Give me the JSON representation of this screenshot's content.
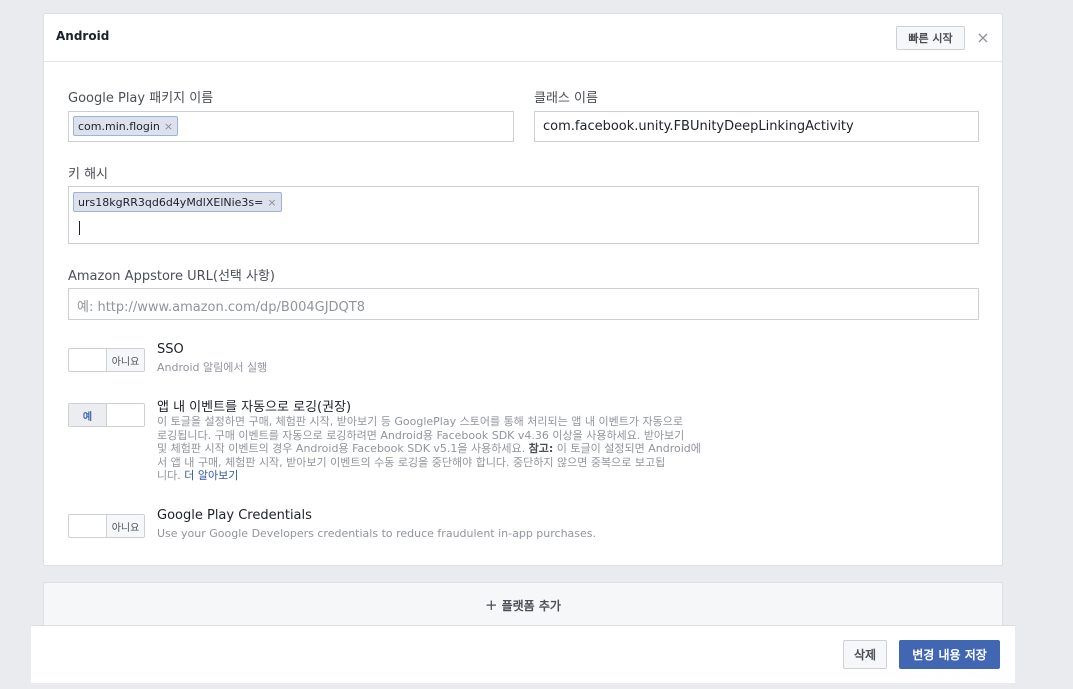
{
  "panel": {
    "title": "Android",
    "quick_start_label": "빠른 시작",
    "close_glyph": "×"
  },
  "package": {
    "label": "Google Play 패키지 이름",
    "token": "com.min.flogin",
    "token_remove": "×"
  },
  "class_name": {
    "label": "클래스 이름",
    "value": "com.facebook.unity.FBUnityDeepLinkingActivity"
  },
  "key_hash": {
    "label": "키 해시",
    "token": "urs18kgRR3qd6d4yMdlXElNie3s=",
    "token_remove": "×"
  },
  "amazon": {
    "label": "Amazon Appstore URL(선택 사항)",
    "placeholder": "예: http://www.amazon.com/dp/B004GJDQT8"
  },
  "sso": {
    "title": "SSO",
    "desc": "Android 알림에서 실행",
    "toggle_label": "아니요",
    "enabled": false
  },
  "auto_log": {
    "title": "앱 내 이벤트를 자동으로 로깅(권장)",
    "desc_lines": [
      "이 토글을 설정하면 구매, 체험판 시작, 받아보기 등 GooglePlay 스토어를 통해 처리되는 앱 내 이벤트가 자동으로",
      "로깅됩니다. 구매 이벤트를 자동으로 로깅하려면 Android용 Facebook SDK v4.36 이상을 사용하세요. 받아보기",
      "및 체험판 시작 이벤트의 경우 Android용 Facebook SDK v5.1을 사용하세요."
    ],
    "note_bold": "참고:",
    "note_line3_rest": " 이 토글이 설정되면 Android에",
    "note_line4": "서 앱 내 구매, 체험판 시작, 받아보기 이벤트의 수동 로깅을 중단해야 합니다. 중단하지 않으면 중복으로 보고됩",
    "note_line5": "니다. ",
    "learn_more": "더 알아보기",
    "toggle_label": "예",
    "enabled": true
  },
  "credentials": {
    "title": "Google Play Credentials",
    "desc": "Use your Google Developers credentials to reduce fraudulent in-app purchases.",
    "toggle_label": "아니요",
    "enabled": false
  },
  "add_platform": {
    "plus": "+",
    "label": "플랫폼 추가"
  },
  "footer": {
    "delete_label": "삭제",
    "save_label": "변경 내용 저장"
  },
  "colors": {
    "accent": "#4267b2",
    "background": "#e9ebee",
    "link": "#365899"
  }
}
